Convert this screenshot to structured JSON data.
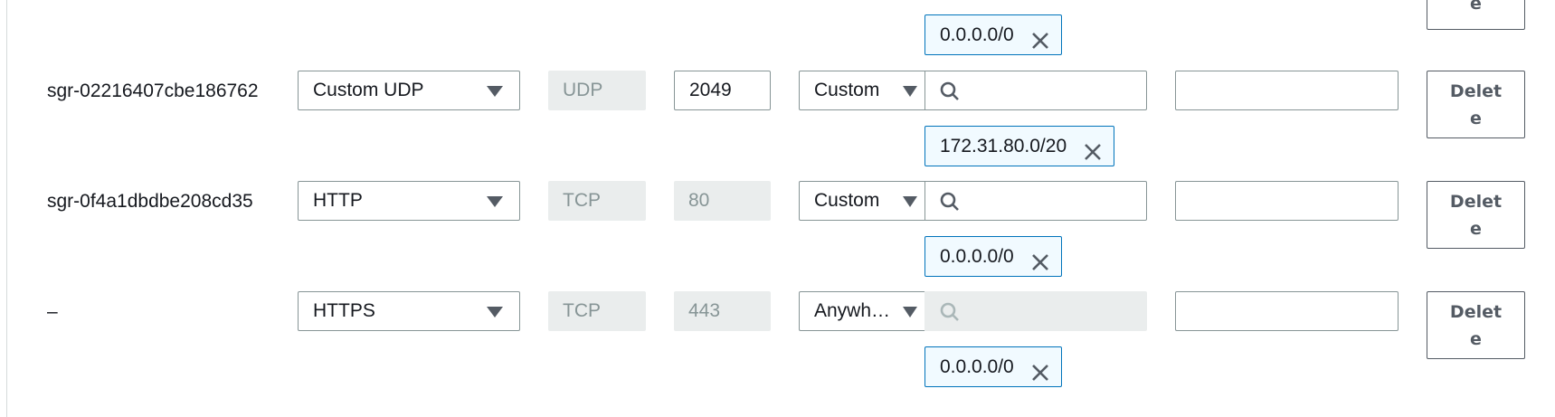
{
  "rows": [
    {
      "rule_id": "",
      "type": "",
      "protocol": "",
      "port": "",
      "source_type": "",
      "source_cidr": "0.0.0.0/0",
      "delete_label": "Delete"
    },
    {
      "rule_id": "sgr-02216407cbe186762",
      "type": "Custom UDP",
      "protocol": "UDP",
      "port": "2049",
      "source_type": "Custom",
      "source_cidr": "172.31.80.0/20",
      "delete_label": "Delete"
    },
    {
      "rule_id": "sgr-0f4a1dbdbe208cd35",
      "type": "HTTP",
      "protocol": "TCP",
      "port": "80",
      "source_type": "Custom",
      "source_cidr": "0.0.0.0/0",
      "delete_label": "Delete"
    },
    {
      "rule_id": "–",
      "type": "HTTPS",
      "protocol": "TCP",
      "port": "443",
      "source_type": "Anywh…",
      "source_cidr": "0.0.0.0/0",
      "delete_label": "Delete"
    }
  ],
  "icons": {
    "search": "search-icon",
    "caret": "caret-down-icon",
    "remove": "close-icon"
  },
  "colors": {
    "token_border": "#0073bb",
    "token_bg": "#f1faff",
    "disabled_bg": "#eaeded",
    "input_border": "#879596"
  }
}
